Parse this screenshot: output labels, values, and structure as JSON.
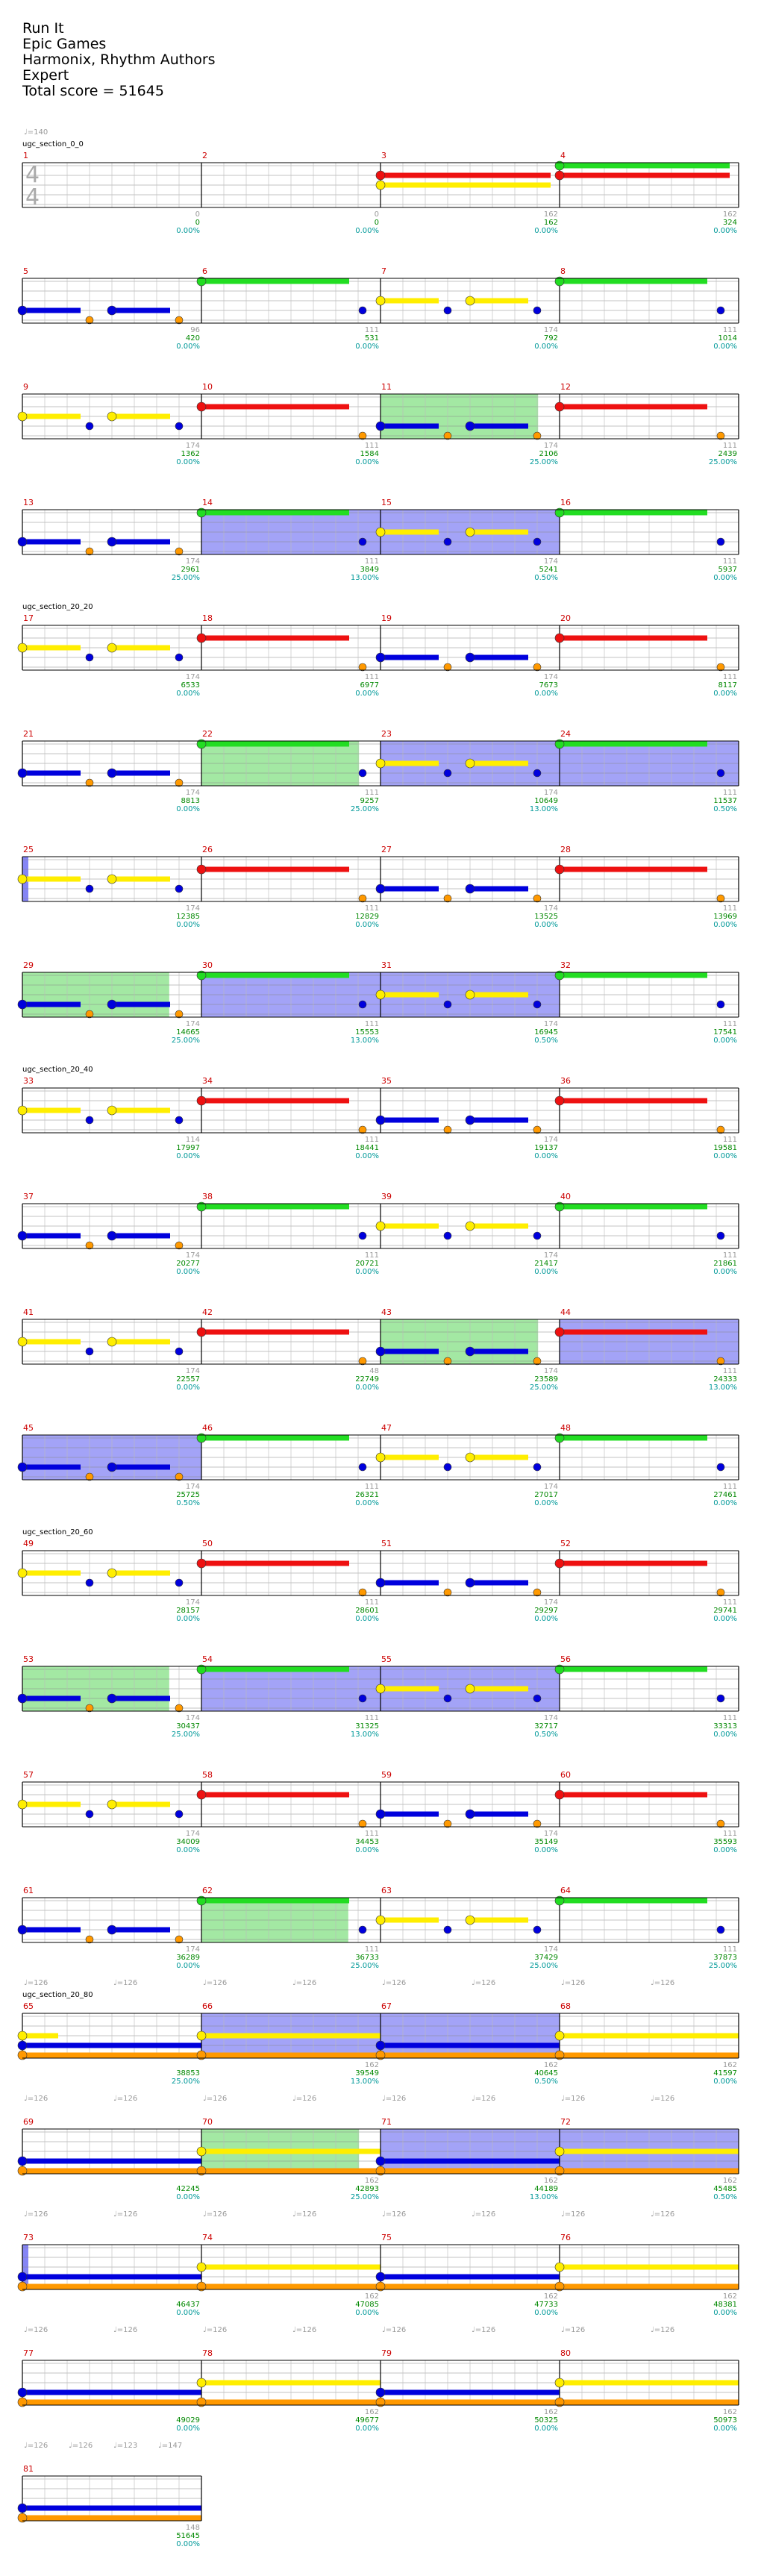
{
  "header": {
    "title": "Run It",
    "artist": "Epic Games",
    "authors": "Harmonix, Rhythm Authors",
    "difficulty": "Expert",
    "total_score": "Total score = 51645"
  },
  "time_signature": {
    "top": "4",
    "bottom": "4"
  },
  "colors": {
    "green": "#22dd22",
    "red": "#ee1111",
    "yellow": "#ffee00",
    "blue": "#0000dd",
    "orange": "#ff9900",
    "overdrive": "#3333ee",
    "solo": "#33cc33",
    "tempo": "#999999",
    "section": "#000000",
    "measure_number": "#cc0000",
    "score": "#008800",
    "percent": "#009999"
  },
  "rows": [
    {
      "measures": [
        1,
        2,
        3,
        4
      ],
      "section": "ugc_section_0_0",
      "tempos": [
        "♩=140"
      ],
      "scores": [
        {
          "n": "0",
          "s": "0",
          "p": "0.00%"
        },
        {
          "n": "0",
          "s": "0",
          "p": "0.00%"
        },
        {
          "n": "162",
          "s": "162",
          "p": "0.00%"
        },
        {
          "n": "162",
          "s": "324",
          "p": "0.00%"
        }
      ]
    },
    {
      "measures": [
        5,
        6,
        7,
        8
      ],
      "scores": [
        {
          "n": "96",
          "s": "420",
          "p": "0.00%"
        },
        {
          "n": "111",
          "s": "531",
          "p": "0.00%"
        },
        {
          "n": "174",
          "s": "792",
          "p": "0.00%"
        },
        {
          "n": "111",
          "s": "1014",
          "p": "0.00%"
        }
      ]
    },
    {
      "measures": [
        9,
        10,
        11,
        12
      ],
      "scores": [
        {
          "n": "174",
          "s": "1362",
          "p": "0.00%"
        },
        {
          "n": "111",
          "s": "1584",
          "p": "0.00%"
        },
        {
          "n": "174",
          "s": "2106",
          "p": "25.00%"
        },
        {
          "n": "111",
          "s": "2439",
          "p": "25.00%"
        }
      ]
    },
    {
      "measures": [
        13,
        14,
        15,
        16
      ],
      "scores": [
        {
          "n": "174",
          "s": "2961",
          "p": "25.00%"
        },
        {
          "n": "111",
          "s": "3849",
          "p": "13.00%"
        },
        {
          "n": "174",
          "s": "5241",
          "p": "0.50%"
        },
        {
          "n": "111",
          "s": "5937",
          "p": "0.00%"
        }
      ]
    },
    {
      "measures": [
        17,
        18,
        19,
        20
      ],
      "section": "ugc_section_20_20",
      "scores": [
        {
          "n": "174",
          "s": "6533",
          "p": "0.00%"
        },
        {
          "n": "111",
          "s": "6977",
          "p": "0.00%"
        },
        {
          "n": "174",
          "s": "7673",
          "p": "0.00%"
        },
        {
          "n": "111",
          "s": "8117",
          "p": "0.00%"
        }
      ]
    },
    {
      "measures": [
        21,
        22,
        23,
        24
      ],
      "scores": [
        {
          "n": "174",
          "s": "8813",
          "p": "0.00%"
        },
        {
          "n": "111",
          "s": "9257",
          "p": "25.00%"
        },
        {
          "n": "174",
          "s": "10649",
          "p": "13.00%"
        },
        {
          "n": "111",
          "s": "11537",
          "p": "0.50%"
        }
      ]
    },
    {
      "measures": [
        25,
        26,
        27,
        28
      ],
      "scores": [
        {
          "n": "174",
          "s": "12385",
          "p": "0.00%"
        },
        {
          "n": "111",
          "s": "12829",
          "p": "0.00%"
        },
        {
          "n": "174",
          "s": "13525",
          "p": "0.00%"
        },
        {
          "n": "111",
          "s": "13969",
          "p": "0.00%"
        }
      ]
    },
    {
      "measures": [
        29,
        30,
        31,
        32
      ],
      "scores": [
        {
          "n": "174",
          "s": "14665",
          "p": "25.00%"
        },
        {
          "n": "111",
          "s": "15553",
          "p": "13.00%"
        },
        {
          "n": "174",
          "s": "16945",
          "p": "0.50%"
        },
        {
          "n": "111",
          "s": "17541",
          "p": "0.00%"
        }
      ]
    },
    {
      "measures": [
        33,
        34,
        35,
        36
      ],
      "section": "ugc_section_20_40",
      "scores": [
        {
          "n": "114",
          "s": "17997",
          "p": "0.00%"
        },
        {
          "n": "111",
          "s": "18441",
          "p": "0.00%"
        },
        {
          "n": "174",
          "s": "19137",
          "p": "0.00%"
        },
        {
          "n": "111",
          "s": "19581",
          "p": "0.00%"
        }
      ]
    },
    {
      "measures": [
        37,
        38,
        39,
        40
      ],
      "scores": [
        {
          "n": "174",
          "s": "20277",
          "p": "0.00%"
        },
        {
          "n": "111",
          "s": "20721",
          "p": "0.00%"
        },
        {
          "n": "174",
          "s": "21417",
          "p": "0.00%"
        },
        {
          "n": "111",
          "s": "21861",
          "p": "0.00%"
        }
      ]
    },
    {
      "measures": [
        41,
        42,
        43,
        44
      ],
      "scores": [
        {
          "n": "174",
          "s": "22557",
          "p": "0.00%"
        },
        {
          "n": "48",
          "s": "22749",
          "p": "0.00%"
        },
        {
          "n": "174",
          "s": "23589",
          "p": "25.00%"
        },
        {
          "n": "111",
          "s": "24333",
          "p": "13.00%"
        }
      ]
    },
    {
      "measures": [
        45,
        46,
        47,
        48
      ],
      "scores": [
        {
          "n": "174",
          "s": "25725",
          "p": "0.50%"
        },
        {
          "n": "111",
          "s": "26321",
          "p": "0.00%"
        },
        {
          "n": "174",
          "s": "27017",
          "p": "0.00%"
        },
        {
          "n": "111",
          "s": "27461",
          "p": "0.00%"
        }
      ]
    },
    {
      "measures": [
        49,
        50,
        51,
        52
      ],
      "section": "ugc_section_20_60",
      "scores": [
        {
          "n": "174",
          "s": "28157",
          "p": "0.00%"
        },
        {
          "n": "111",
          "s": "28601",
          "p": "0.00%"
        },
        {
          "n": "174",
          "s": "29297",
          "p": "0.00%"
        },
        {
          "n": "111",
          "s": "29741",
          "p": "0.00%"
        }
      ]
    },
    {
      "measures": [
        53,
        54,
        55,
        56
      ],
      "scores": [
        {
          "n": "174",
          "s": "30437",
          "p": "25.00%"
        },
        {
          "n": "111",
          "s": "31325",
          "p": "13.00%"
        },
        {
          "n": "174",
          "s": "32717",
          "p": "0.50%"
        },
        {
          "n": "111",
          "s": "33313",
          "p": "0.00%"
        }
      ]
    },
    {
      "measures": [
        57,
        58,
        59,
        60
      ],
      "scores": [
        {
          "n": "174",
          "s": "34009",
          "p": "0.00%"
        },
        {
          "n": "111",
          "s": "34453",
          "p": "0.00%"
        },
        {
          "n": "174",
          "s": "35149",
          "p": "0.00%"
        },
        {
          "n": "111",
          "s": "35593",
          "p": "0.00%"
        }
      ]
    },
    {
      "measures": [
        61,
        62,
        63,
        64
      ],
      "scores": [
        {
          "n": "174",
          "s": "36289",
          "p": "0.00%"
        },
        {
          "n": "111",
          "s": "36733",
          "p": "25.00%"
        },
        {
          "n": "174",
          "s": "37429",
          "p": "25.00%"
        },
        {
          "n": "111",
          "s": "37873",
          "p": "25.00%"
        }
      ]
    },
    {
      "measures": [
        65,
        66,
        67,
        68
      ],
      "section": "ugc_section_20_80",
      "tempos": [
        "♩=126",
        "♩=126",
        "♩=126",
        "♩=126",
        "♩=126",
        "♩=126",
        "♩=126",
        "♩=126"
      ],
      "scores": [
        {
          "n": "",
          "s": "38853",
          "p": "25.00%"
        },
        {
          "n": "162",
          "s": "39549",
          "p": "13.00%"
        },
        {
          "n": "162",
          "s": "40645",
          "p": "0.50%"
        },
        {
          "n": "162",
          "s": "41597",
          "p": "0.00%"
        }
      ]
    },
    {
      "measures": [
        69,
        70,
        71,
        72
      ],
      "tempos": [
        "♩=126",
        "♩=126",
        "♩=126",
        "♩=126",
        "♩=126",
        "♩=126",
        "♩=126",
        "♩=126"
      ],
      "scores": [
        {
          "n": "",
          "s": "42245",
          "p": "0.00%"
        },
        {
          "n": "162",
          "s": "42893",
          "p": "25.00%"
        },
        {
          "n": "162",
          "s": "44189",
          "p": "13.00%"
        },
        {
          "n": "162",
          "s": "45485",
          "p": "0.50%"
        }
      ]
    },
    {
      "measures": [
        73,
        74,
        75,
        76
      ],
      "tempos": [
        "♩=126",
        "♩=126",
        "♩=126",
        "♩=126",
        "♩=126",
        "♩=126",
        "♩=126",
        "♩=126"
      ],
      "scores": [
        {
          "n": "",
          "s": "46437",
          "p": "0.00%"
        },
        {
          "n": "162",
          "s": "47085",
          "p": "0.00%"
        },
        {
          "n": "162",
          "s": "47733",
          "p": "0.00%"
        },
        {
          "n": "162",
          "s": "48381",
          "p": "0.00%"
        }
      ]
    },
    {
      "measures": [
        77,
        78,
        79,
        80
      ],
      "tempos": [
        "♩=126",
        "♩=126",
        "♩=126",
        "♩=126",
        "♩=126",
        "♩=126",
        "♩=126",
        "♩=126"
      ],
      "scores": [
        {
          "n": "",
          "s": "49029",
          "p": "0.00%"
        },
        {
          "n": "162",
          "s": "49677",
          "p": "0.00%"
        },
        {
          "n": "162",
          "s": "50325",
          "p": "0.00%"
        },
        {
          "n": "162",
          "s": "50973",
          "p": "0.00%"
        }
      ]
    },
    {
      "measures": [
        81
      ],
      "tempos": [
        "♩=126",
        "♩=126",
        "♩=123",
        "♩=147"
      ],
      "scores": [
        {
          "n": "148",
          "s": "51645",
          "p": "0.00%"
        }
      ]
    }
  ]
}
